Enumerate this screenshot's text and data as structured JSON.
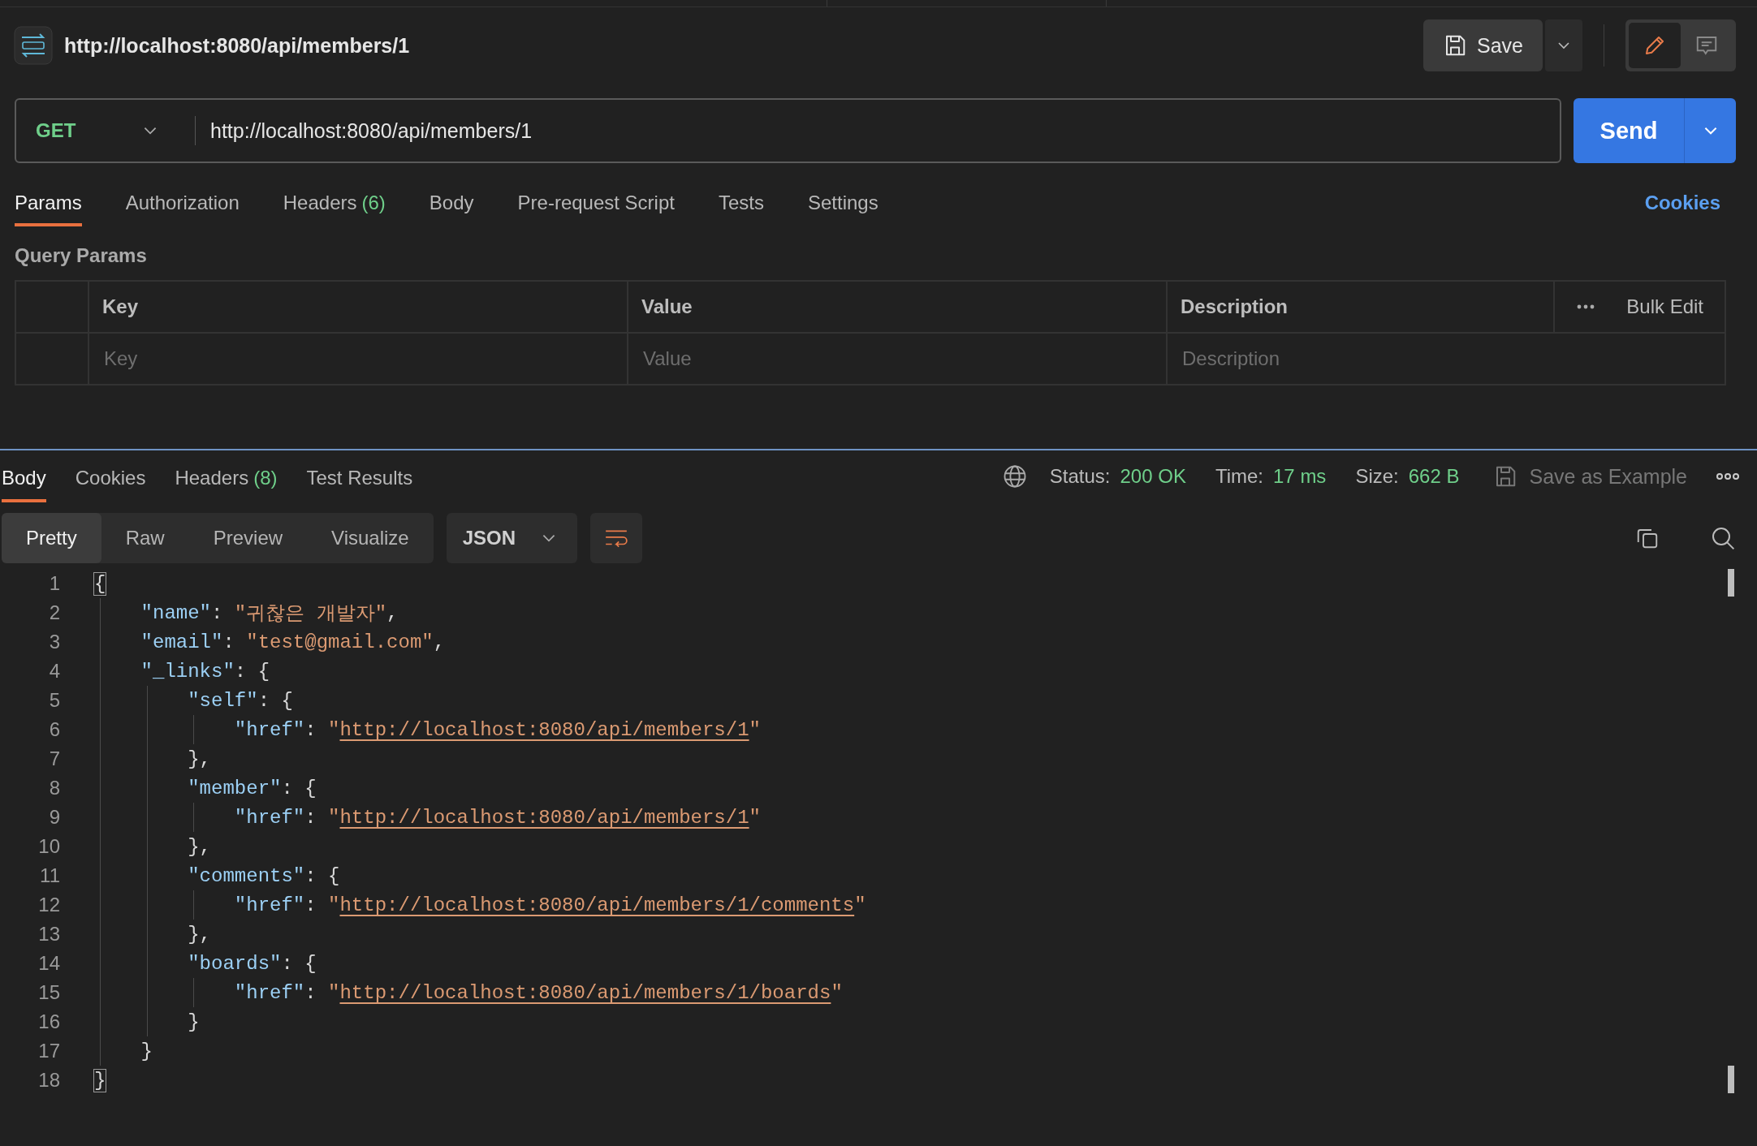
{
  "request": {
    "title": "http://localhost:8080/api/members/1",
    "save_label": "Save",
    "method": "GET",
    "url": "http://localhost:8080/api/members/1",
    "send_label": "Send",
    "mode_edit_selected": true
  },
  "request_tabs": [
    {
      "label": "Params",
      "selected": true
    },
    {
      "label": "Authorization",
      "selected": false
    },
    {
      "label": "Headers",
      "count": "(6)",
      "selected": false
    },
    {
      "label": "Body",
      "selected": false
    },
    {
      "label": "Pre-request Script",
      "selected": false
    },
    {
      "label": "Tests",
      "selected": false
    },
    {
      "label": "Settings",
      "selected": false
    }
  ],
  "cookies_link": "Cookies",
  "query_params": {
    "title": "Query Params",
    "columns": [
      "Key",
      "Value",
      "Description"
    ],
    "bulk_edit": "Bulk Edit",
    "placeholders": [
      "Key",
      "Value",
      "Description"
    ]
  },
  "response_tabs": [
    {
      "label": "Body",
      "selected": true
    },
    {
      "label": "Cookies",
      "selected": false
    },
    {
      "label": "Headers",
      "count": "(8)",
      "selected": false
    },
    {
      "label": "Test Results",
      "selected": false
    }
  ],
  "response_status": [
    {
      "label": "Status:",
      "value": "200 OK"
    },
    {
      "label": "Time:",
      "value": "17 ms"
    },
    {
      "label": "Size:",
      "value": "662 B"
    }
  ],
  "save_example": "Save as Example",
  "view_modes": [
    {
      "label": "Pretty",
      "selected": true
    },
    {
      "label": "Raw",
      "selected": false
    },
    {
      "label": "Preview",
      "selected": false
    },
    {
      "label": "Visualize",
      "selected": false
    }
  ],
  "format": "JSON",
  "code_lines": [
    {
      "number": "1",
      "tokens": [
        {
          "kind": "brace",
          "text": "{",
          "matched": true
        }
      ]
    },
    {
      "number": "2",
      "tokens": [
        {
          "kind": "key",
          "text": "    \"name\""
        },
        {
          "kind": "punct",
          "text": ": "
        },
        {
          "kind": "string",
          "text": "\"귀찮은 개발자\""
        },
        {
          "kind": "punct",
          "text": ","
        }
      ]
    },
    {
      "number": "3",
      "tokens": [
        {
          "kind": "key",
          "text": "    \"email\""
        },
        {
          "kind": "punct",
          "text": ": "
        },
        {
          "kind": "string",
          "text": "\"test@gmail.com\""
        },
        {
          "kind": "punct",
          "text": ","
        }
      ]
    },
    {
      "number": "4",
      "tokens": [
        {
          "kind": "key",
          "text": "    \"_links\""
        },
        {
          "kind": "punct",
          "text": ": {"
        }
      ]
    },
    {
      "number": "5",
      "tokens": [
        {
          "kind": "key",
          "text": "        \"self\""
        },
        {
          "kind": "punct",
          "text": ": {"
        }
      ]
    },
    {
      "number": "6",
      "tokens": [
        {
          "kind": "key",
          "text": "            \"href\""
        },
        {
          "kind": "punct",
          "text": ": "
        },
        {
          "kind": "string",
          "text": "\""
        },
        {
          "kind": "link",
          "text": "http://localhost:8080/api/members/1"
        },
        {
          "kind": "string",
          "text": "\""
        }
      ]
    },
    {
      "number": "7",
      "tokens": [
        {
          "kind": "punct",
          "text": "        },"
        }
      ]
    },
    {
      "number": "8",
      "tokens": [
        {
          "kind": "key",
          "text": "        \"member\""
        },
        {
          "kind": "punct",
          "text": ": {"
        }
      ]
    },
    {
      "number": "9",
      "tokens": [
        {
          "kind": "key",
          "text": "            \"href\""
        },
        {
          "kind": "punct",
          "text": ": "
        },
        {
          "kind": "string",
          "text": "\""
        },
        {
          "kind": "link",
          "text": "http://localhost:8080/api/members/1"
        },
        {
          "kind": "string",
          "text": "\""
        }
      ]
    },
    {
      "number": "10",
      "tokens": [
        {
          "kind": "punct",
          "text": "        },"
        }
      ]
    },
    {
      "number": "11",
      "tokens": [
        {
          "kind": "key",
          "text": "        \"comments\""
        },
        {
          "kind": "punct",
          "text": ": {"
        }
      ]
    },
    {
      "number": "12",
      "tokens": [
        {
          "kind": "key",
          "text": "            \"href\""
        },
        {
          "kind": "punct",
          "text": ": "
        },
        {
          "kind": "string",
          "text": "\""
        },
        {
          "kind": "link",
          "text": "http://localhost:8080/api/members/1/comments"
        },
        {
          "kind": "string",
          "text": "\""
        }
      ]
    },
    {
      "number": "13",
      "tokens": [
        {
          "kind": "punct",
          "text": "        },"
        }
      ]
    },
    {
      "number": "14",
      "tokens": [
        {
          "kind": "key",
          "text": "        \"boards\""
        },
        {
          "kind": "punct",
          "text": ": {"
        }
      ]
    },
    {
      "number": "15",
      "tokens": [
        {
          "kind": "key",
          "text": "            \"href\""
        },
        {
          "kind": "punct",
          "text": ": "
        },
        {
          "kind": "string",
          "text": "\""
        },
        {
          "kind": "link",
          "text": "http://localhost:8080/api/members/1/boards"
        },
        {
          "kind": "string",
          "text": "\""
        }
      ]
    },
    {
      "number": "16",
      "tokens": [
        {
          "kind": "punct",
          "text": "        }"
        }
      ]
    },
    {
      "number": "17",
      "tokens": [
        {
          "kind": "punct",
          "text": "    }"
        }
      ]
    },
    {
      "number": "18",
      "tokens": [
        {
          "kind": "brace",
          "text": "}",
          "matched": true
        }
      ]
    }
  ]
}
